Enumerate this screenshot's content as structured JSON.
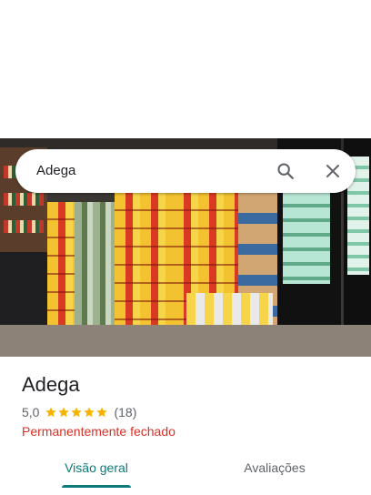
{
  "search": {
    "query": "Adega",
    "search_icon": "search-icon",
    "clear_icon": "close-icon"
  },
  "place": {
    "name": "Adega",
    "rating": "5,0",
    "stars": 5,
    "star_color": "#f6b400",
    "review_count": "(18)",
    "status": "Permanentemente fechado",
    "status_color": "#d93025"
  },
  "tabs": [
    {
      "label": "Visão geral",
      "active": true
    },
    {
      "label": "Avaliações",
      "active": false
    }
  ],
  "colors": {
    "accent": "#0b7a79"
  }
}
